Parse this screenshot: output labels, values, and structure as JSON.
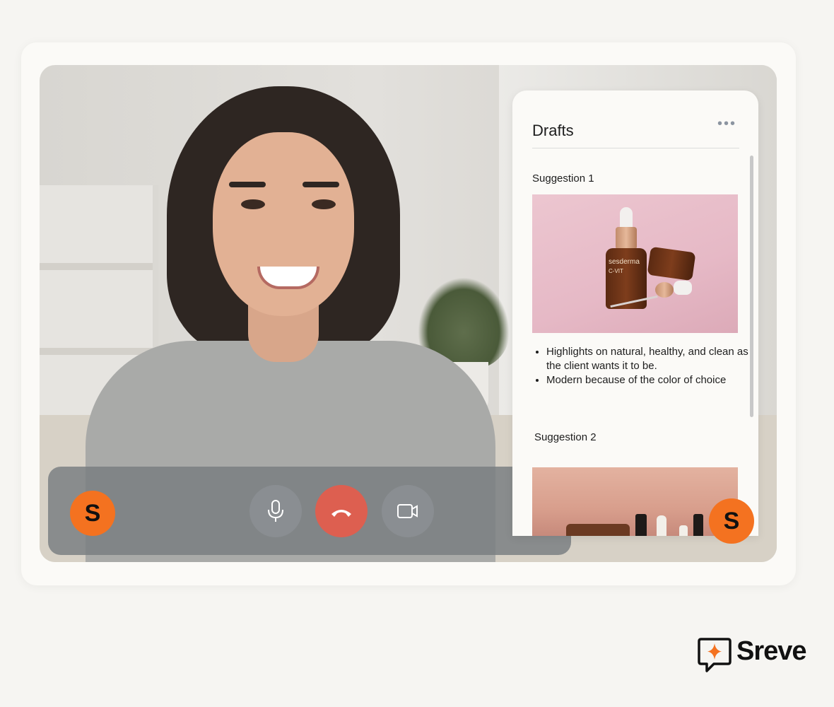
{
  "call": {
    "local_avatar_initial": "S",
    "remote_avatar_initial": "S"
  },
  "controls": {
    "mic_icon": "microphone-icon",
    "hangup_icon": "phone-hangup-icon",
    "camera_icon": "video-camera-icon"
  },
  "drafts_panel": {
    "title": "Drafts",
    "more_icon": "more-horizontal-icon",
    "suggestions": [
      {
        "label": "Suggestion 1",
        "image_text": {
          "brand": "sesderma",
          "product": "C-VIT"
        },
        "bullets": [
          "Highlights on natural, healthy, and clean as the client wants it to be.",
          "Modern because of the color of choice"
        ]
      },
      {
        "label": "Suggestion 2"
      }
    ]
  },
  "brand": {
    "name": "Sreve",
    "logo_icon": "chat-sparkle-icon"
  },
  "colors": {
    "accent_orange": "#f47220",
    "hangup_red": "#dd5f50",
    "background": "#f6f5f2"
  }
}
